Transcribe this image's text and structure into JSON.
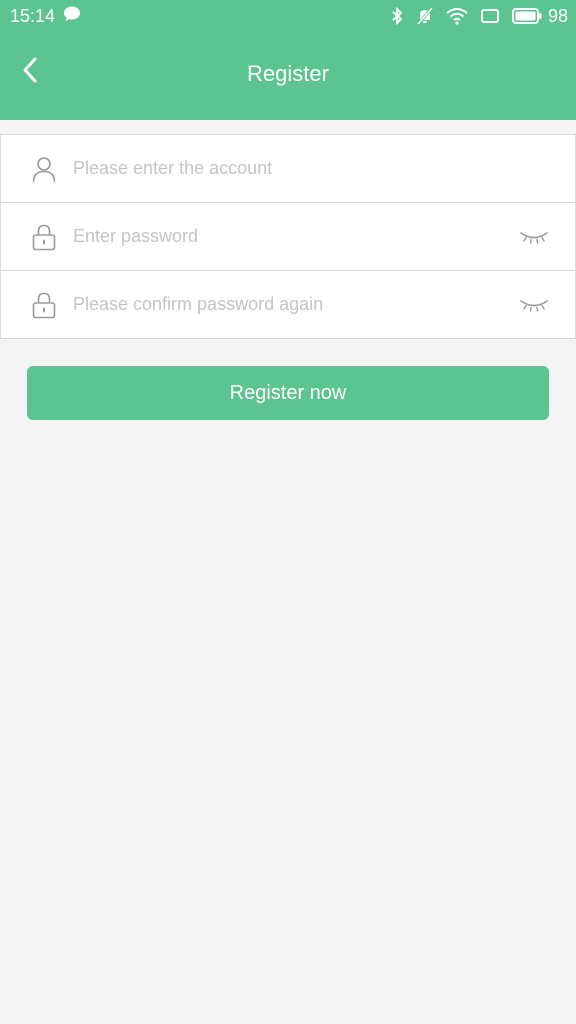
{
  "status_bar": {
    "time": "15:14",
    "battery_level": "98",
    "icons": [
      "chat-bubble-icon",
      "bluetooth-icon",
      "notifications-off-icon",
      "wifi-icon",
      "screen-icon",
      "battery-icon"
    ]
  },
  "app_bar": {
    "title": "Register",
    "back_icon": "chevron-left-icon"
  },
  "form": {
    "account": {
      "placeholder": "Please enter the account",
      "value": "",
      "icon": "user-icon"
    },
    "password": {
      "placeholder": "Enter password",
      "value": "",
      "icon": "lock-icon",
      "toggle_icon": "eye-closed-icon"
    },
    "confirm_password": {
      "placeholder": "Please confirm password again",
      "value": "",
      "icon": "lock-icon",
      "toggle_icon": "eye-closed-icon"
    }
  },
  "actions": {
    "register_label": "Register now"
  },
  "colors": {
    "primary": "#5bc48f",
    "background": "#f4f4f4",
    "placeholder": "#c4c4c4"
  }
}
